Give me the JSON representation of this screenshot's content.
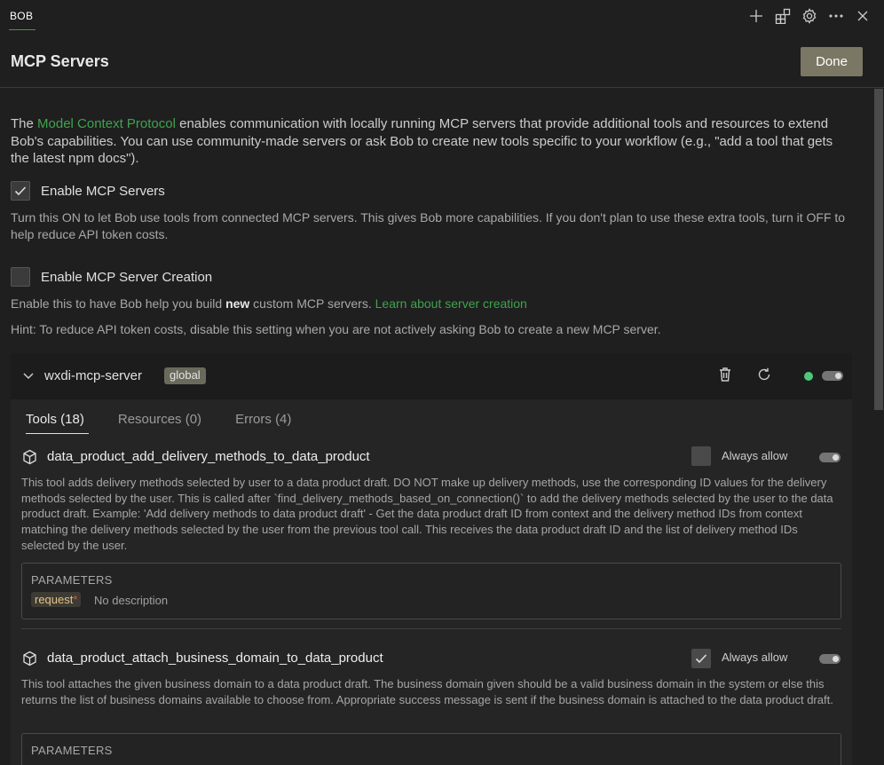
{
  "topbar": {
    "tab_label": "BOB",
    "icons": [
      "plus-icon",
      "extensions-icon",
      "gear-icon",
      "more-icon",
      "close-icon"
    ]
  },
  "header": {
    "title": "MCP Servers",
    "done_label": "Done"
  },
  "intro": {
    "text_before": "The ",
    "link_text": "Model Context Protocol",
    "text_after": " enables communication with locally running MCP servers that provide additional tools and resources to extend Bob's capabilities. You can use community-made servers or ask Bob to create new tools specific to your workflow (e.g., \"add a tool that gets the latest npm docs\")."
  },
  "enable_servers": {
    "label": "Enable MCP Servers",
    "checked": true,
    "description": "Turn this ON to let Bob use tools from connected MCP servers. This gives Bob more capabilities. If you don't plan to use these extra tools, turn it OFF to help reduce API token costs."
  },
  "enable_creation": {
    "label": "Enable MCP Server Creation",
    "checked": false,
    "desc_before": "Enable this to have Bob help you build ",
    "desc_bold": "new",
    "desc_after": " custom MCP servers. ",
    "desc_link": "Learn about server creation",
    "hint": "Hint: To reduce API token costs, disable this setting when you are not actively asking Bob to create a new MCP server."
  },
  "server": {
    "name": "wxdi-mcp-server",
    "badge": "global",
    "tabs": [
      {
        "label": "Tools (18)",
        "active": true
      },
      {
        "label": "Resources (0)",
        "active": false
      },
      {
        "label": "Errors (4)",
        "active": false
      }
    ],
    "tools": [
      {
        "name": "data_product_add_delivery_methods_to_data_product",
        "always_allow_label": "Always allow",
        "always_allow": false,
        "description": "This tool adds delivery methods selected by user to a data product draft. DO NOT make up delivery methods, use the corresponding ID values for the delivery methods selected by the user. This is called after `find_delivery_methods_based_on_connection()` to add the delivery methods selected by the user to the data product draft. Example: 'Add delivery methods to data product draft' - Get the data product draft ID from context and the delivery method IDs from context matching the delivery methods selected by the user from the previous tool call. This receives the data product draft ID and the list of delivery method IDs selected by the user.",
        "params_title": "PARAMETERS",
        "param_name": "request",
        "param_required": "*",
        "param_desc": "No description"
      },
      {
        "name": "data_product_attach_business_domain_to_data_product",
        "always_allow_label": "Always allow",
        "always_allow": true,
        "description": "This tool attaches the given business domain to a data product draft. The business domain given should be a valid business domain in the system or else this returns the list of business domains available to choose from. Appropriate success message is sent if the business domain is attached to the data product draft.",
        "params_title": "PARAMETERS"
      }
    ]
  },
  "colors": {
    "accent_green": "#3fa34d",
    "status_green": "#4ec97a",
    "done_button": "#7a7764"
  }
}
